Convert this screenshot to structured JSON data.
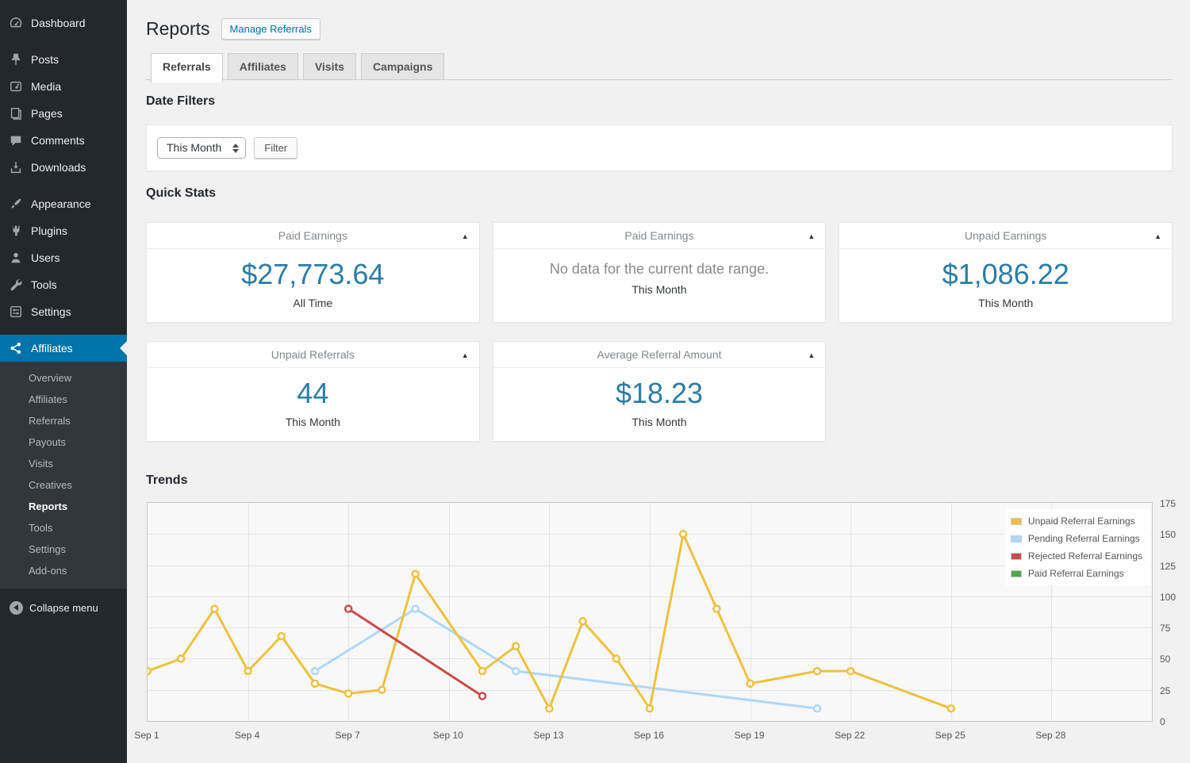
{
  "colors": {
    "accent": "#0073aa",
    "sidebar_active": "#0073aa",
    "stat_value": "#2d7ca5"
  },
  "icons": {
    "card_toggle": "▲"
  },
  "sidebar": {
    "items": [
      {
        "label": "Dashboard",
        "icon": "dashboard-icon"
      },
      {
        "label": "Posts",
        "icon": "pin-icon"
      },
      {
        "label": "Media",
        "icon": "media-icon"
      },
      {
        "label": "Pages",
        "icon": "pages-icon"
      },
      {
        "label": "Comments",
        "icon": "comment-icon"
      },
      {
        "label": "Downloads",
        "icon": "download-icon"
      },
      {
        "label": "Appearance",
        "icon": "brush-icon"
      },
      {
        "label": "Plugins",
        "icon": "plugin-icon"
      },
      {
        "label": "Users",
        "icon": "user-icon"
      },
      {
        "label": "Tools",
        "icon": "wrench-icon"
      },
      {
        "label": "Settings",
        "icon": "settings-icon"
      },
      {
        "label": "Affiliates",
        "icon": "affiliates-icon",
        "active": true
      }
    ],
    "submenu": [
      "Overview",
      "Affiliates",
      "Referrals",
      "Payouts",
      "Visits",
      "Creatives",
      "Reports",
      "Tools",
      "Settings",
      "Add-ons"
    ],
    "submenu_current": "Reports",
    "collapse_label": "Collapse menu"
  },
  "header": {
    "title": "Reports",
    "action_button": "Manage Referrals"
  },
  "tabs": [
    {
      "label": "Referrals",
      "active": true
    },
    {
      "label": "Affiliates",
      "active": false
    },
    {
      "label": "Visits",
      "active": false
    },
    {
      "label": "Campaigns",
      "active": false
    }
  ],
  "date_filters": {
    "heading": "Date Filters",
    "select_value": "This Month",
    "filter_button": "Filter"
  },
  "quick_stats": {
    "heading": "Quick Stats",
    "cards": [
      {
        "title": "Paid Earnings",
        "value": "$27,773.64",
        "caption": "All Time"
      },
      {
        "title": "Paid Earnings",
        "message": "No data for the current date range.",
        "caption": "This Month"
      },
      {
        "title": "Unpaid Earnings",
        "value": "$1,086.22",
        "caption": "This Month"
      },
      {
        "title": "Unpaid Referrals",
        "value": "44",
        "caption": "This Month"
      },
      {
        "title": "Average Referral Amount",
        "value": "$18.23",
        "caption": "This Month"
      }
    ]
  },
  "trends": {
    "heading": "Trends"
  },
  "chart_data": {
    "type": "line",
    "title": "Trends",
    "x_unit": "day of September",
    "x_range": [
      1,
      31
    ],
    "ylim": [
      0,
      175
    ],
    "y_ticks": [
      0,
      25,
      50,
      75,
      100,
      125,
      150,
      175
    ],
    "x_ticks": [
      {
        "day": 1,
        "label": "Sep 1"
      },
      {
        "day": 4,
        "label": "Sep 4"
      },
      {
        "day": 7,
        "label": "Sep 7"
      },
      {
        "day": 10,
        "label": "Sep 10"
      },
      {
        "day": 13,
        "label": "Sep 13"
      },
      {
        "day": 16,
        "label": "Sep 16"
      },
      {
        "day": 19,
        "label": "Sep 19"
      },
      {
        "day": 22,
        "label": "Sep 22"
      },
      {
        "day": 25,
        "label": "Sep 25"
      },
      {
        "day": 28,
        "label": "Sep 28"
      }
    ],
    "grid": true,
    "legend_position": "top-right",
    "series": [
      {
        "name": "Unpaid Referral Earnings",
        "color": "#edc240",
        "z": 2,
        "points": [
          [
            1,
            40
          ],
          [
            2,
            50
          ],
          [
            3,
            90
          ],
          [
            4,
            40
          ],
          [
            5,
            68
          ],
          [
            6,
            30
          ],
          [
            7,
            22
          ],
          [
            8,
            25
          ],
          [
            9,
            118
          ],
          [
            11,
            40
          ],
          [
            12,
            60
          ],
          [
            13,
            10
          ],
          [
            14,
            80
          ],
          [
            15,
            50
          ],
          [
            16,
            10
          ],
          [
            17,
            150
          ],
          [
            18,
            90
          ],
          [
            19,
            30
          ],
          [
            21,
            40
          ],
          [
            22,
            40
          ],
          [
            25,
            10
          ]
        ]
      },
      {
        "name": "Pending Referral Earnings",
        "color": "#afd8f8",
        "z": 1,
        "points": [
          [
            6,
            40
          ],
          [
            9,
            90
          ],
          [
            12,
            40
          ],
          [
            21,
            10
          ]
        ]
      },
      {
        "name": "Rejected Referral Earnings",
        "color": "#cb4b4b",
        "z": 3,
        "points": [
          [
            7,
            90
          ],
          [
            11,
            20
          ]
        ]
      },
      {
        "name": "Paid Referral Earnings",
        "color": "#4da74d",
        "z": 0,
        "points": []
      }
    ]
  }
}
